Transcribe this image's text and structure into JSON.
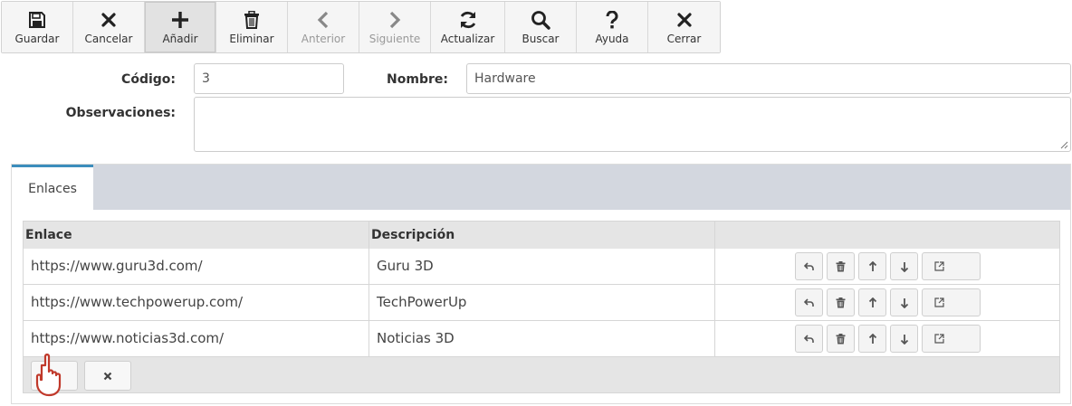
{
  "toolbar": {
    "buttons": [
      {
        "id": "guardar",
        "label": "Guardar",
        "icon": "save-icon"
      },
      {
        "id": "cancelar",
        "label": "Cancelar",
        "icon": "x-icon"
      },
      {
        "id": "anadir",
        "label": "Añadir",
        "icon": "plus-icon",
        "state": "pressed"
      },
      {
        "id": "eliminar",
        "label": "Eliminar",
        "icon": "trash-icon"
      },
      {
        "id": "anterior",
        "label": "Anterior",
        "icon": "chevron-left-icon",
        "state": "disabled"
      },
      {
        "id": "siguiente",
        "label": "Siguiente",
        "icon": "chevron-right-icon",
        "state": "disabled"
      },
      {
        "id": "actualizar",
        "label": "Actualizar",
        "icon": "refresh-icon"
      },
      {
        "id": "buscar",
        "label": "Buscar",
        "icon": "search-icon"
      },
      {
        "id": "ayuda",
        "label": "Ayuda",
        "icon": "question-icon"
      },
      {
        "id": "cerrar",
        "label": "Cerrar",
        "icon": "x-icon"
      }
    ]
  },
  "form": {
    "codigo_label": "Código:",
    "codigo_value": "3",
    "nombre_label": "Nombre:",
    "nombre_value": "Hardware",
    "observaciones_label": "Observaciones:",
    "observaciones_value": ""
  },
  "tabs": [
    {
      "label": "Enlaces",
      "active": true
    }
  ],
  "links_table": {
    "columns": [
      "Enlace",
      "Descripción",
      ""
    ],
    "rows": [
      {
        "enlace": "https://www.guru3d.com/",
        "descripcion": "Guru 3D"
      },
      {
        "enlace": "https://www.techpowerup.com/",
        "descripcion": "TechPowerUp"
      },
      {
        "enlace": "https://www.noticias3d.com/",
        "descripcion": "Noticias 3D"
      }
    ],
    "row_actions": [
      "undo-icon",
      "trash-icon",
      "arrow-up-icon",
      "arrow-down-icon",
      "external-link-icon"
    ],
    "footer_buttons": [
      "plus-icon",
      "x-icon"
    ]
  },
  "colors": {
    "tab_accent": "#3c8dbc",
    "tab_strip": "#d3d7df",
    "cursor_hand": "#c0392b"
  }
}
